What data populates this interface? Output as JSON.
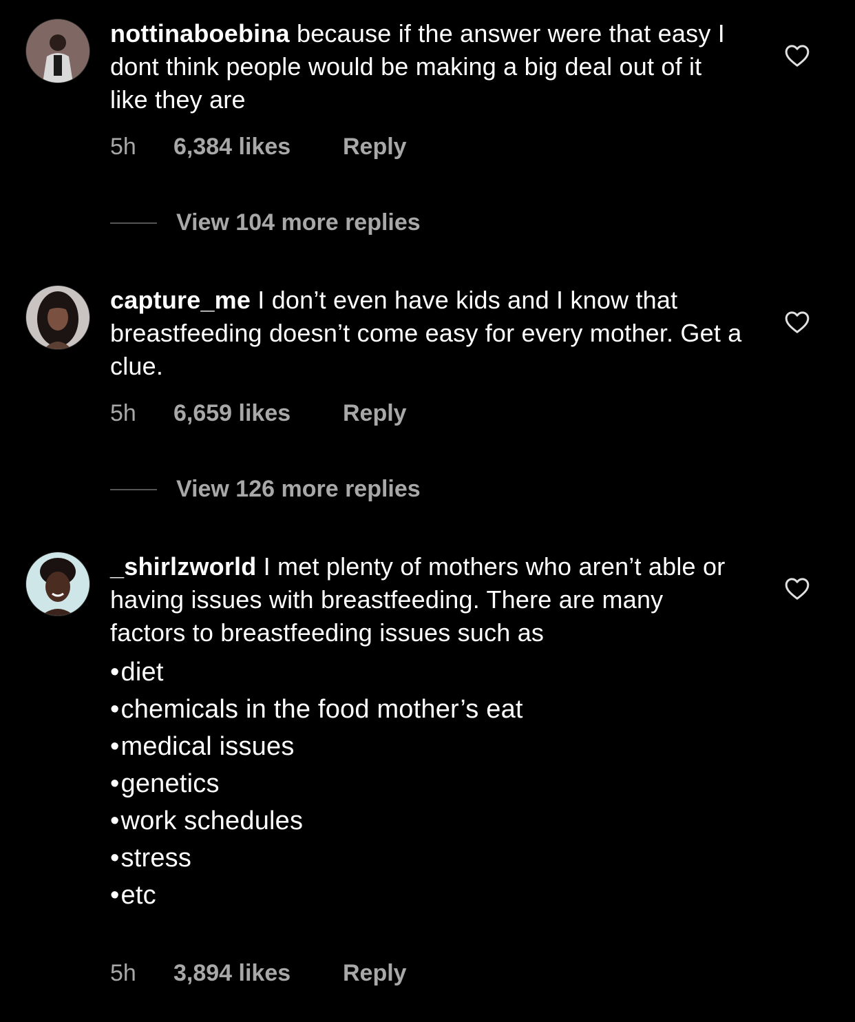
{
  "comments": [
    {
      "username": "nottinaboebina",
      "text": " because if the answer were that easy I dont think people would be making a big deal out of it like they are",
      "time": "5h",
      "likes": "6,384 likes",
      "reply": "Reply",
      "view_replies": "View 104 more replies"
    },
    {
      "username": "capture_me",
      "text": " I don’t even have kids and I know that breastfeeding doesn’t come easy for every mother. Get a clue.",
      "time": "5h",
      "likes": "6,659 likes",
      "reply": "Reply",
      "view_replies": "View 126 more replies"
    },
    {
      "username": "_shirlzworld",
      "text": " I met plenty of mothers who aren’t able or having issues with breastfeeding. There are many factors to breastfeeding issues such as",
      "bullets": [
        "diet",
        "chemicals in the food mother’s eat",
        "medical issues",
        "genetics",
        "work schedules",
        "stress",
        "etc"
      ],
      "time": "5h",
      "likes": "3,894 likes",
      "reply": "Reply"
    }
  ],
  "colors": {
    "background": "#000000",
    "text": "#ffffff",
    "secondary": "#a8a8a8"
  },
  "icons": {
    "like": "heart-outline-icon"
  }
}
